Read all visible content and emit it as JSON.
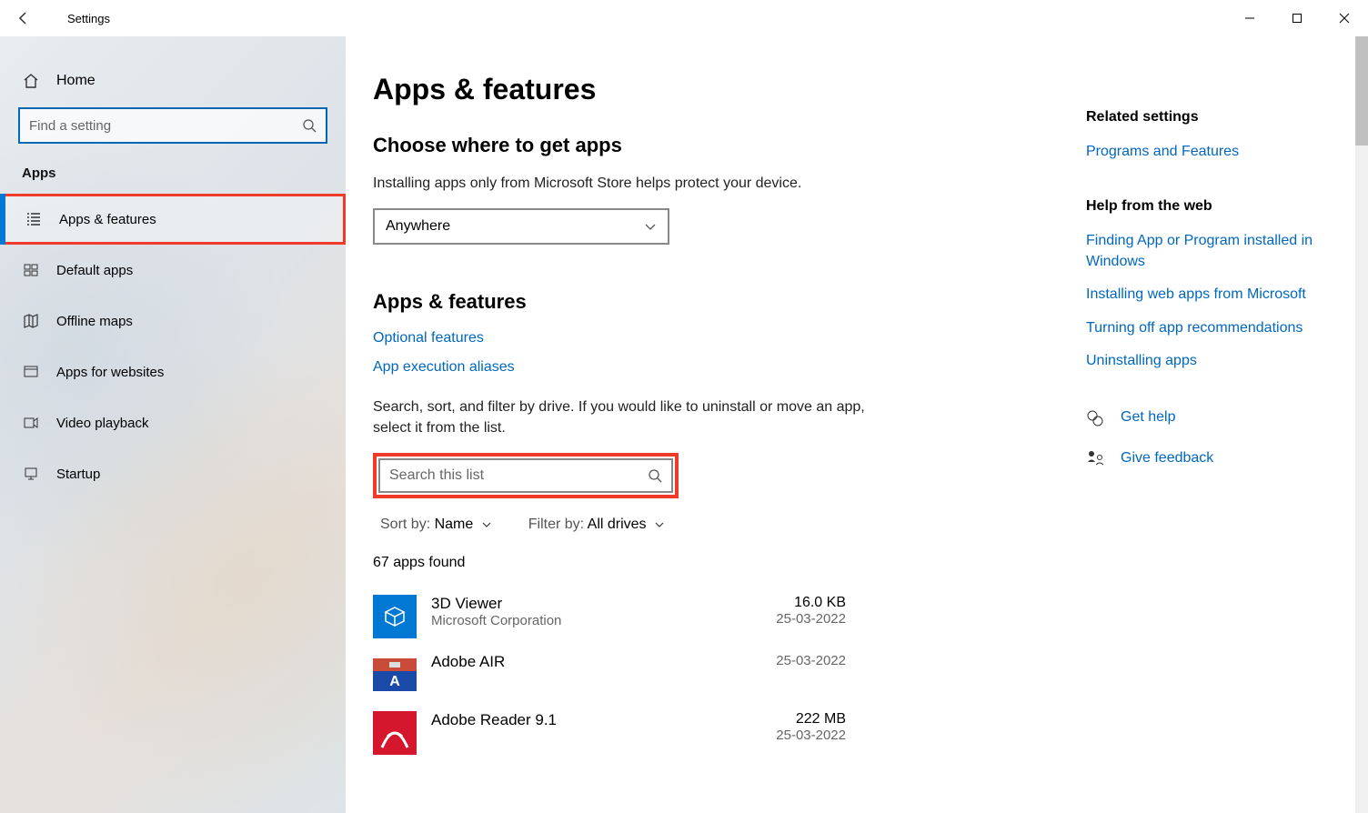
{
  "titlebar": {
    "title": "Settings"
  },
  "sidebar": {
    "home": "Home",
    "search_placeholder": "Find a setting",
    "section": "Apps",
    "items": [
      {
        "label": "Apps & features"
      },
      {
        "label": "Default apps"
      },
      {
        "label": "Offline maps"
      },
      {
        "label": "Apps for websites"
      },
      {
        "label": "Video playback"
      },
      {
        "label": "Startup"
      }
    ]
  },
  "main": {
    "h1": "Apps & features",
    "choose_head": "Choose where to get apps",
    "choose_desc": "Installing apps only from Microsoft Store helps protect your device.",
    "combo_value": "Anywhere",
    "sub_head": "Apps & features",
    "link_optional": "Optional features",
    "link_aliases": "App execution aliases",
    "search_desc": "Search, sort, and filter by drive. If you would like to uninstall or move an app, select it from the list.",
    "search_placeholder": "Search this list",
    "sort_label": "Sort by:",
    "sort_value": "Name",
    "filter_label": "Filter by:",
    "filter_value": "All drives",
    "count": "67 apps found",
    "apps": [
      {
        "name": "3D Viewer",
        "publisher": "Microsoft Corporation",
        "size": "16.0 KB",
        "date": "25-03-2022"
      },
      {
        "name": "Adobe AIR",
        "publisher": "",
        "size": "",
        "date": "25-03-2022"
      },
      {
        "name": "Adobe Reader 9.1",
        "publisher": "",
        "size": "222 MB",
        "date": "25-03-2022"
      }
    ]
  },
  "rail": {
    "related_head": "Related settings",
    "related_link": "Programs and Features",
    "help_head": "Help from the web",
    "help_links": [
      "Finding App or Program installed in Windows",
      "Installing web apps from Microsoft",
      "Turning off app recommendations",
      "Uninstalling apps"
    ],
    "get_help": "Get help",
    "give_feedback": "Give feedback"
  }
}
